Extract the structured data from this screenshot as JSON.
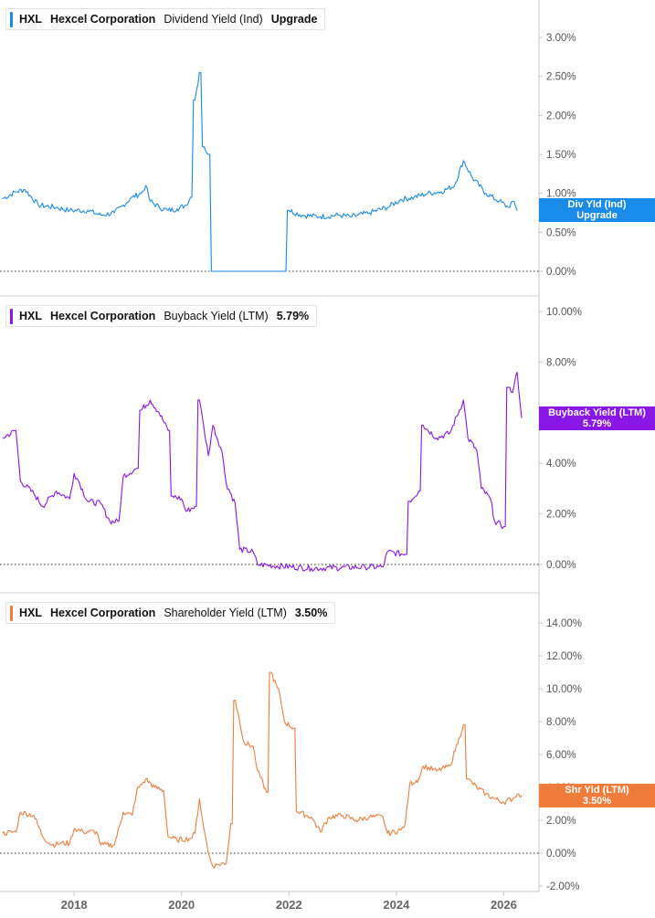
{
  "colors": {
    "dividend": "#1a8be8",
    "buyback": "#8a17e6",
    "shareholder": "#f07c3c",
    "axis": "#c8c8c8",
    "zero_line": "#333333"
  },
  "x_axis": {
    "ticks": [
      "2018",
      "2020",
      "2022",
      "2024",
      "2026"
    ]
  },
  "chart_data": [
    {
      "type": "line",
      "ticker": "HXL",
      "company": "Hexcel Corporation",
      "metric": "Dividend Yield (Ind)",
      "legend_value": "Upgrade",
      "badge": {
        "line1": "Div Yld (Ind)",
        "line2": "Upgrade"
      },
      "ylim": [
        0,
        3.4
      ],
      "yticks": [
        "3.00%",
        "2.50%",
        "2.00%",
        "1.50%",
        "1.00%",
        "0.50%",
        "0.00%"
      ],
      "ytick_values": [
        3,
        2.5,
        2,
        1.5,
        1,
        0.5,
        0
      ],
      "series": [
        {
          "values_by_date": [
            [
              "2016-09",
              0.93
            ],
            [
              "2016-12",
              1.02
            ],
            [
              "2017-02",
              1.05
            ],
            [
              "2017-05",
              0.85
            ],
            [
              "2017-09",
              0.82
            ],
            [
              "2017-12",
              0.78
            ],
            [
              "2018-04",
              0.78
            ],
            [
              "2018-07",
              0.72
            ],
            [
              "2018-10",
              0.75
            ],
            [
              "2018-12",
              0.85
            ],
            [
              "2019-02",
              0.95
            ],
            [
              "2019-04",
              1.0
            ],
            [
              "2019-05",
              1.1
            ],
            [
              "2019-06",
              0.9
            ],
            [
              "2019-08",
              0.82
            ],
            [
              "2019-10",
              0.78
            ],
            [
              "2019-12",
              0.8
            ],
            [
              "2020-02",
              0.85
            ],
            [
              "2020-03",
              0.95
            ],
            [
              "2020-04",
              2.2
            ],
            [
              "2020-05",
              2.55
            ],
            [
              "2020-06",
              1.6
            ],
            [
              "2020-07",
              1.5
            ],
            [
              "2020-08",
              0.0
            ],
            [
              "2021-12",
              0.0
            ],
            [
              "2022-01",
              0.78
            ],
            [
              "2022-04",
              0.72
            ],
            [
              "2022-08",
              0.7
            ],
            [
              "2022-12",
              0.72
            ],
            [
              "2023-03",
              0.7
            ],
            [
              "2023-07",
              0.75
            ],
            [
              "2023-11",
              0.82
            ],
            [
              "2024-02",
              0.92
            ],
            [
              "2024-05",
              0.95
            ],
            [
              "2024-08",
              1.0
            ],
            [
              "2024-11",
              1.02
            ],
            [
              "2025-02",
              1.1
            ],
            [
              "2025-04",
              1.42
            ],
            [
              "2025-06",
              1.2
            ],
            [
              "2025-09",
              1.0
            ],
            [
              "2025-12",
              0.9
            ],
            [
              "2026-02",
              0.82
            ],
            [
              "2026-03",
              0.9
            ],
            [
              "2026-04",
              0.78
            ]
          ]
        }
      ]
    },
    {
      "type": "line",
      "ticker": "HXL",
      "company": "Hexcel Corporation",
      "metric": "Buyback Yield (LTM)",
      "legend_value": "5.79%",
      "badge": {
        "line1": "Buyback Yield (LTM)",
        "line2": "5.79%"
      },
      "ylim": [
        -0.5,
        10.8
      ],
      "yticks": [
        "10.00%",
        "8.00%",
        "6.00%",
        "4.00%",
        "2.00%",
        "0.00%"
      ],
      "ytick_values": [
        10,
        8,
        6,
        4,
        2,
        0
      ],
      "series": [
        {
          "values_by_date": [
            [
              "2016-09",
              5.0
            ],
            [
              "2016-12",
              5.3
            ],
            [
              "2017-01",
              3.3
            ],
            [
              "2017-04",
              2.8
            ],
            [
              "2017-06",
              2.3
            ],
            [
              "2017-09",
              2.9
            ],
            [
              "2017-12",
              2.6
            ],
            [
              "2018-01",
              3.6
            ],
            [
              "2018-02",
              3.3
            ],
            [
              "2018-04",
              2.5
            ],
            [
              "2018-07",
              2.4
            ],
            [
              "2018-09",
              1.7
            ],
            [
              "2018-11",
              1.7
            ],
            [
              "2018-12",
              3.5
            ],
            [
              "2019-03",
              3.8
            ],
            [
              "2019-04",
              6.1
            ],
            [
              "2019-06",
              6.5
            ],
            [
              "2019-08",
              6.0
            ],
            [
              "2019-10",
              5.3
            ],
            [
              "2019-11",
              2.7
            ],
            [
              "2020-01",
              2.6
            ],
            [
              "2020-02",
              2.1
            ],
            [
              "2020-04",
              2.3
            ],
            [
              "2020-05",
              6.5
            ],
            [
              "2020-06",
              5.4
            ],
            [
              "2020-07",
              4.3
            ],
            [
              "2020-08",
              5.5
            ],
            [
              "2020-10",
              4.5
            ],
            [
              "2020-11",
              3.2
            ],
            [
              "2021-01",
              2.4
            ],
            [
              "2021-02",
              0.6
            ],
            [
              "2021-05",
              0.5
            ],
            [
              "2021-06",
              0.0
            ],
            [
              "2022-06",
              -0.15
            ],
            [
              "2023-06",
              -0.1
            ],
            [
              "2023-10",
              -0.1
            ],
            [
              "2023-11",
              0.5
            ],
            [
              "2024-03",
              0.4
            ],
            [
              "2024-04",
              2.5
            ],
            [
              "2024-06",
              2.9
            ],
            [
              "2024-07",
              5.5
            ],
            [
              "2024-10",
              5.0
            ],
            [
              "2025-01",
              5.2
            ],
            [
              "2025-04",
              6.5
            ],
            [
              "2025-05",
              5.0
            ],
            [
              "2025-07",
              4.5
            ],
            [
              "2025-08",
              3.0
            ],
            [
              "2025-10",
              2.6
            ],
            [
              "2025-11",
              1.7
            ],
            [
              "2026-01",
              1.5
            ],
            [
              "2026-02",
              7.0
            ],
            [
              "2026-03",
              6.8
            ],
            [
              "2026-04",
              7.6
            ],
            [
              "2026-05",
              5.79
            ]
          ]
        }
      ]
    },
    {
      "type": "line",
      "ticker": "HXL",
      "company": "Hexcel Corporation",
      "metric": "Shareholder Yield (LTM)",
      "legend_value": "3.50%",
      "badge": {
        "line1": "Shr Yld (LTM)",
        "line2": "3.50%"
      },
      "ylim": [
        -2.3,
        15.5
      ],
      "yticks": [
        "14.00%",
        "12.00%",
        "10.00%",
        "8.00%",
        "6.00%",
        "4.00%",
        "2.00%",
        "0.00%",
        "-2.00%"
      ],
      "ytick_values": [
        14,
        12,
        10,
        8,
        6,
        4,
        2,
        0,
        -2
      ],
      "series": [
        {
          "values_by_date": [
            [
              "2016-09",
              1.2
            ],
            [
              "2016-12",
              1.3
            ],
            [
              "2017-01",
              2.5
            ],
            [
              "2017-04",
              2.3
            ],
            [
              "2017-06",
              1.0
            ],
            [
              "2017-08",
              0.5
            ],
            [
              "2017-10",
              0.6
            ],
            [
              "2017-12",
              0.6
            ],
            [
              "2018-01",
              1.5
            ],
            [
              "2018-03",
              1.3
            ],
            [
              "2018-06",
              1.3
            ],
            [
              "2018-07",
              0.5
            ],
            [
              "2018-10",
              0.5
            ],
            [
              "2018-12",
              2.5
            ],
            [
              "2019-02",
              2.3
            ],
            [
              "2019-03",
              3.8
            ],
            [
              "2019-05",
              4.5
            ],
            [
              "2019-07",
              4.0
            ],
            [
              "2019-09",
              3.8
            ],
            [
              "2019-10",
              1.0
            ],
            [
              "2019-12",
              0.8
            ],
            [
              "2020-03",
              0.9
            ],
            [
              "2020-04",
              1.2
            ],
            [
              "2020-05",
              3.3
            ],
            [
              "2020-06",
              1.5
            ],
            [
              "2020-07",
              0.0
            ],
            [
              "2020-08",
              -0.8
            ],
            [
              "2020-09",
              -0.7
            ],
            [
              "2020-11",
              -0.6
            ],
            [
              "2020-12",
              1.8
            ],
            [
              "2021-01",
              9.3
            ],
            [
              "2021-02",
              8.0
            ],
            [
              "2021-03",
              6.7
            ],
            [
              "2021-05",
              6.5
            ],
            [
              "2021-06",
              5.0
            ],
            [
              "2021-08",
              3.7
            ],
            [
              "2021-09",
              11.0
            ],
            [
              "2021-11",
              9.6
            ],
            [
              "2021-12",
              8.0
            ],
            [
              "2022-02",
              7.6
            ],
            [
              "2022-03",
              2.5
            ],
            [
              "2022-06",
              2.2
            ],
            [
              "2022-08",
              1.3
            ],
            [
              "2022-10",
              2.2
            ],
            [
              "2023-01",
              2.3
            ],
            [
              "2023-04",
              2.0
            ],
            [
              "2023-07",
              2.2
            ],
            [
              "2023-10",
              2.2
            ],
            [
              "2023-11",
              1.2
            ],
            [
              "2024-02",
              1.4
            ],
            [
              "2024-03",
              1.8
            ],
            [
              "2024-04",
              4.2
            ],
            [
              "2024-06",
              4.5
            ],
            [
              "2024-07",
              5.3
            ],
            [
              "2024-10",
              5.0
            ],
            [
              "2025-01",
              5.3
            ],
            [
              "2025-03",
              7.0
            ],
            [
              "2025-04",
              7.8
            ],
            [
              "2025-05",
              4.5
            ],
            [
              "2025-07",
              4.0
            ],
            [
              "2025-09",
              3.6
            ],
            [
              "2025-11",
              3.3
            ],
            [
              "2026-01",
              3.1
            ],
            [
              "2026-03",
              3.3
            ],
            [
              "2026-04",
              3.6
            ],
            [
              "2026-05",
              3.5
            ]
          ]
        }
      ]
    }
  ]
}
